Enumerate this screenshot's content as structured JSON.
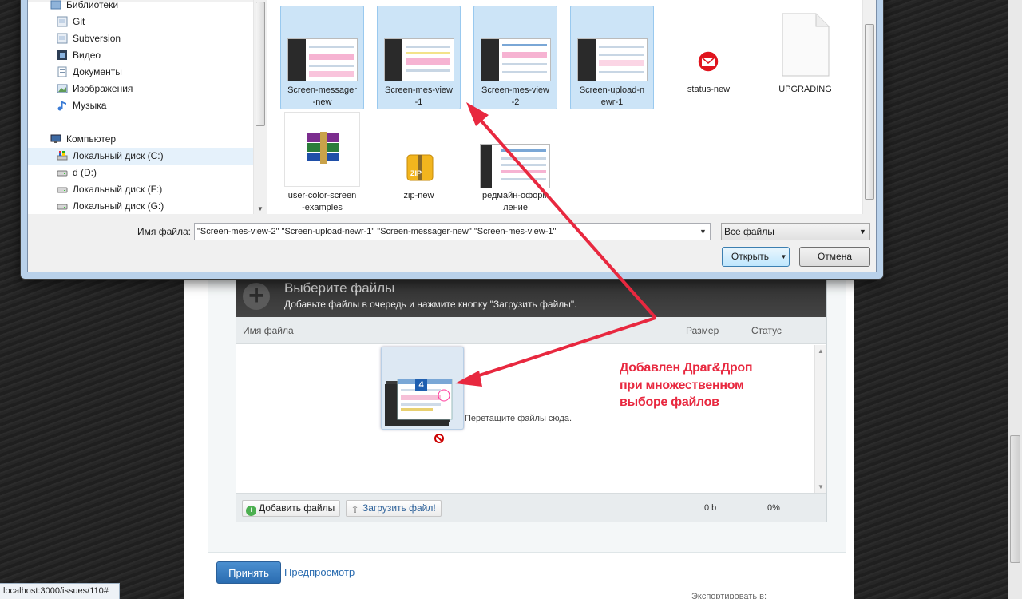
{
  "dialog": {
    "nav": {
      "items": [
        {
          "label": "Библиотеки",
          "icon": "libraries-icon"
        },
        {
          "label": "Git",
          "icon": "library-icon"
        },
        {
          "label": "Subversion",
          "icon": "library-icon"
        },
        {
          "label": "Видео",
          "icon": "video-icon"
        },
        {
          "label": "Документы",
          "icon": "documents-icon"
        },
        {
          "label": "Изображения",
          "icon": "images-icon"
        },
        {
          "label": "Музыка",
          "icon": "music-icon"
        },
        {
          "label": "Компьютер",
          "icon": "computer-icon"
        },
        {
          "label": "Локальный диск (C:)",
          "icon": "drive-icon"
        },
        {
          "label": "d (D:)",
          "icon": "drive-icon"
        },
        {
          "label": "Локальный диск (F:)",
          "icon": "drive-icon"
        },
        {
          "label": "Локальный диск (G:)",
          "icon": "drive-icon"
        }
      ]
    },
    "files": [
      {
        "name": "Screen-messager\n-new",
        "selected": true,
        "kind": "screenshot"
      },
      {
        "name": "Screen-mes-view\n-1",
        "selected": true,
        "kind": "screenshot"
      },
      {
        "name": "Screen-mes-view\n-2",
        "selected": true,
        "kind": "screenshot"
      },
      {
        "name": "Screen-upload-n\newr-1",
        "selected": true,
        "kind": "screenshot"
      },
      {
        "name": "status-new",
        "selected": false,
        "kind": "mail-icon"
      },
      {
        "name": "UPGRADING",
        "selected": false,
        "kind": "document-icon"
      },
      {
        "name": "user-color-screen\n-examples",
        "selected": false,
        "kind": "archive-icon"
      },
      {
        "name": "zip-new",
        "selected": false,
        "kind": "zip-icon"
      },
      {
        "name": "редмайн-оформ\nление",
        "selected": false,
        "kind": "screenshot"
      }
    ],
    "filename_label": "Имя файла:",
    "filename_value": "\"Screen-mes-view-2\" \"Screen-upload-newr-1\" \"Screen-messager-new\" \"Screen-mes-view-1\"",
    "filetype_value": "Все файлы",
    "open_label": "Открыть",
    "cancel_label": "Отмена"
  },
  "uploader": {
    "title": "Выберите файлы",
    "subtitle": "Добавьте файлы в очередь и нажмите кнопку \"Загрузить файлы\".",
    "col_filename": "Имя файла",
    "col_size": "Размер",
    "col_status": "Статус",
    "drag_count": "4",
    "drop_hint": "Перетащите файлы сюда.",
    "add_files_label": "Добавить файлы",
    "upload_label": "Загрузить файл!",
    "total_size": "0 b",
    "total_percent": "0%"
  },
  "annotation": {
    "line1": "Добавлен Драг&Дроп",
    "line2": "при множественном",
    "line3": "выборе файлов",
    "color": "#e8283f"
  },
  "page": {
    "submit_label": "Принять",
    "preview_label": "Предпросмотр",
    "export_text": "Экспортировать в:",
    "status_url": "localhost:3000/issues/110#"
  }
}
